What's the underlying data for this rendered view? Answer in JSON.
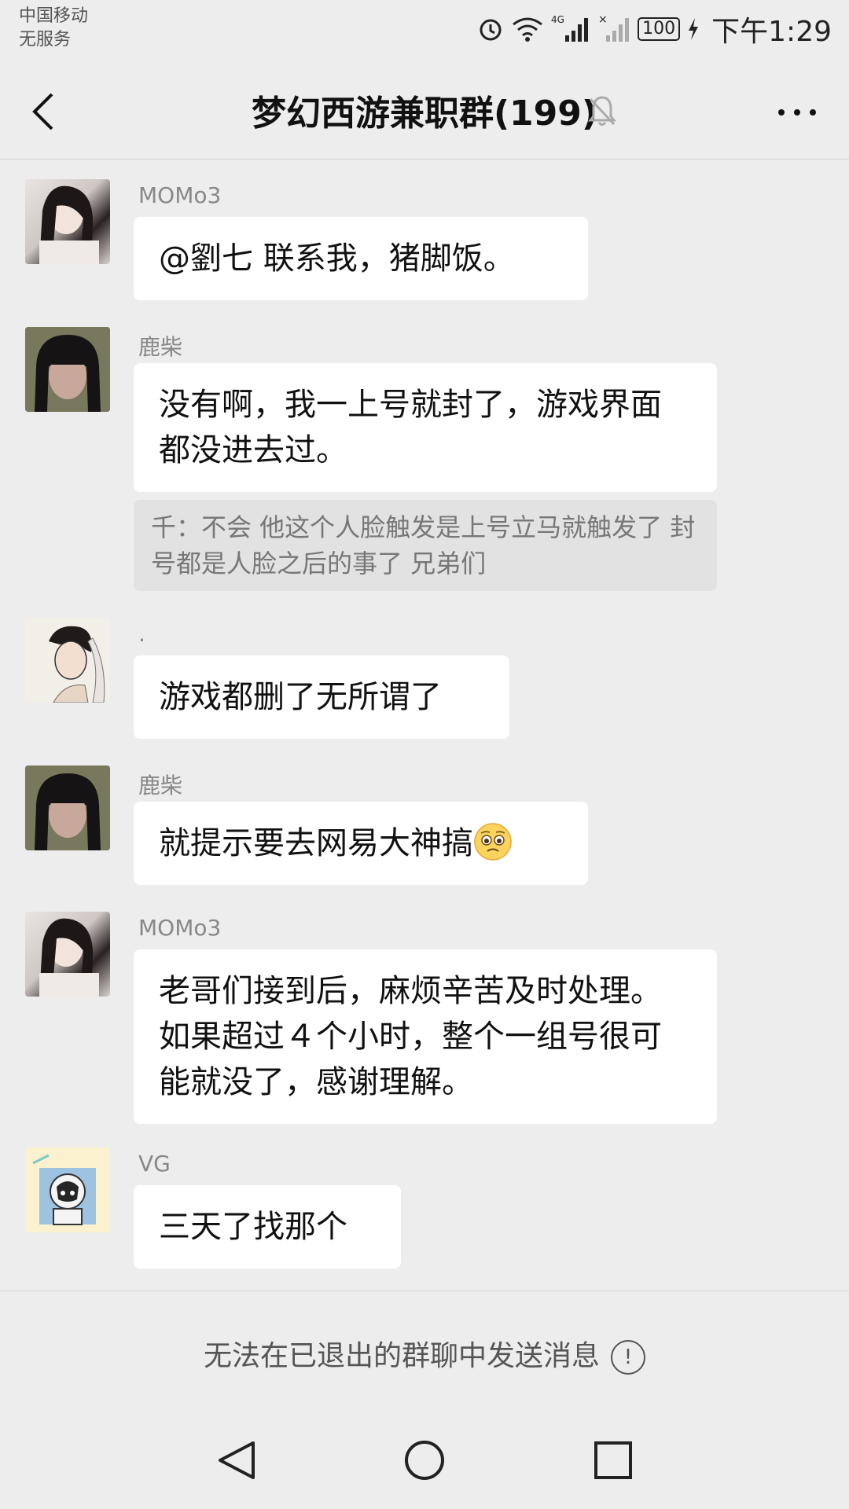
{
  "status": {
    "carrier_line1": "中国移动",
    "carrier_line2": "无服务",
    "network": "4G",
    "battery": "100",
    "time": "下午1:29"
  },
  "header": {
    "title": "梦幻西游兼职群(199)",
    "icons": [
      "back-icon",
      "muted-bell-icon",
      "more-icon"
    ]
  },
  "messages": [
    {
      "sender": "MOMo3",
      "text": "@劉七 联系我，猪脚饭。"
    },
    {
      "sender": "鹿柴",
      "text": "没有啊，我一上号就封了，游戏界面都没进去过。",
      "quote": "千：不会 他这个人脸触发是上号立马就触发了 封号都是人脸之后的事了 兄弟们"
    },
    {
      "sender": ".",
      "text": "游戏都删了无所谓了"
    },
    {
      "sender": "鹿柴",
      "text": "就提示要去网易大神搞",
      "emoji": "pleading-face-emoji"
    },
    {
      "sender": "MOMo3",
      "text": "老哥们接到后，麻烦辛苦及时处理。如果超过４个小时，整个一组号很可能就没了，感谢理解。"
    },
    {
      "sender": "VG",
      "text": "三天了找那个"
    }
  ],
  "footer": {
    "notice": "无法在已退出的群聊中发送消息",
    "notice_icon": "exclamation-circle-icon"
  },
  "navbar": {
    "icons": [
      "nav-back-icon",
      "nav-home-icon",
      "nav-recents-icon"
    ]
  },
  "colors": {
    "background": "#ededed",
    "bubble": "#ffffff",
    "quote": "#e2e2e2"
  }
}
